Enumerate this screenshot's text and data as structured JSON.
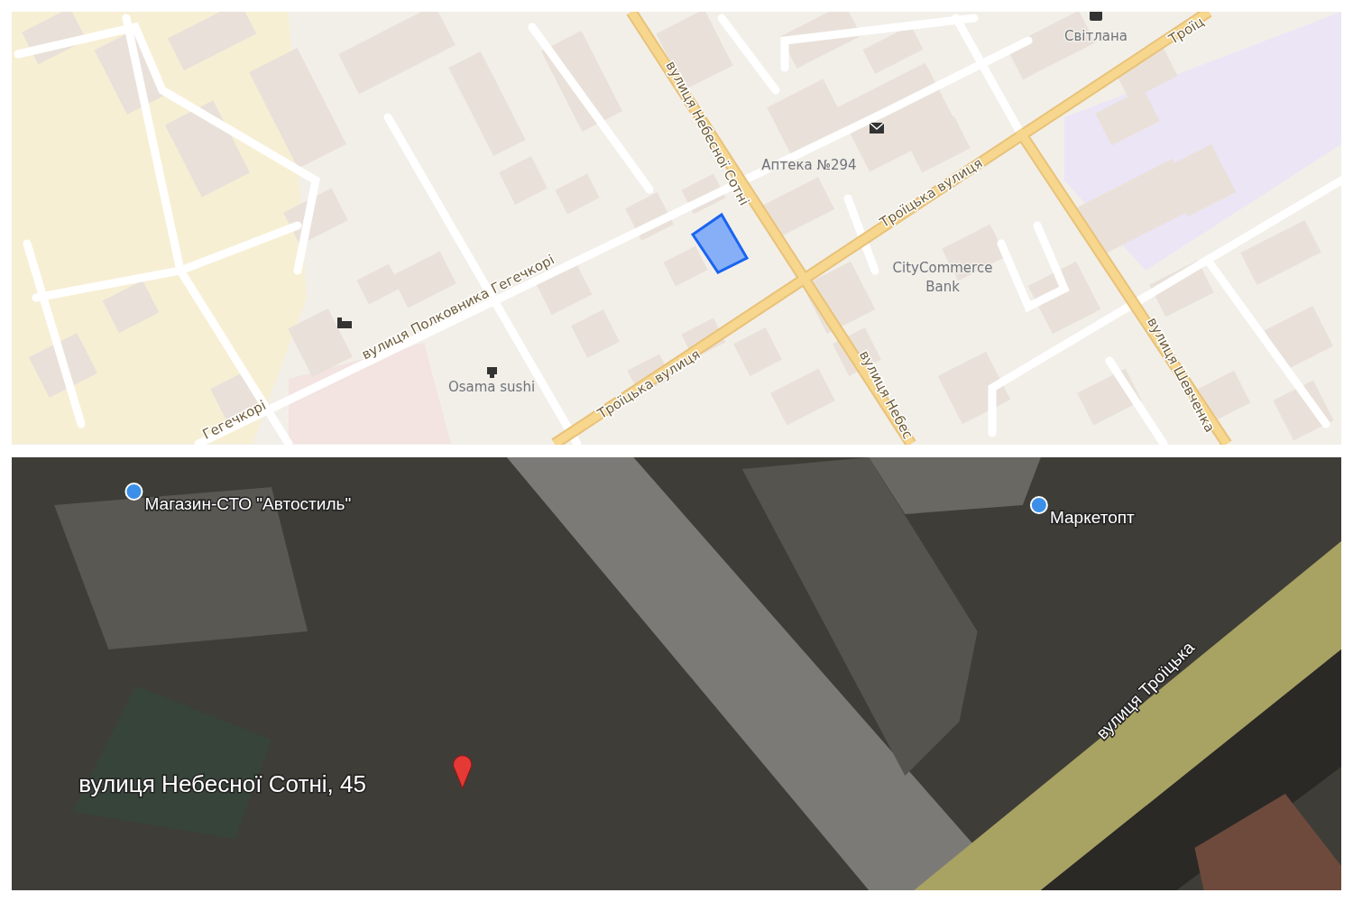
{
  "map_view": {
    "labels": [
      {
        "text": "вулиця Небесної Сотні",
        "kind": "street"
      },
      {
        "text": "Аптека №294",
        "kind": "place"
      },
      {
        "text": "Світлана",
        "kind": "place"
      },
      {
        "text": "Троїц",
        "kind": "street"
      },
      {
        "text": "Троїцька вулиця",
        "kind": "street"
      },
      {
        "text": "CityCommerce",
        "kind": "place"
      },
      {
        "text": "Bank",
        "kind": "place"
      },
      {
        "text": "вулиця Полковника Гегечкорі",
        "kind": "street"
      },
      {
        "text": "Osama sushi",
        "kind": "place"
      },
      {
        "text": "Гегечкорі",
        "kind": "street"
      },
      {
        "text": "Троїцька вулиця",
        "kind": "street"
      },
      {
        "text": "вулиця Небес",
        "kind": "street"
      },
      {
        "text": "вулиця Шевченка",
        "kind": "street"
      }
    ]
  },
  "satellite_view": {
    "labels": [
      {
        "text": "Магазин-СТО \"Автостиль\"",
        "kind": "pin"
      },
      {
        "text": "Маркетопт",
        "kind": "pin"
      },
      {
        "text": "вулиця Троїцька",
        "kind": "street"
      },
      {
        "text": "вулиця Небесної Сотні, 45",
        "kind": "address"
      }
    ]
  }
}
